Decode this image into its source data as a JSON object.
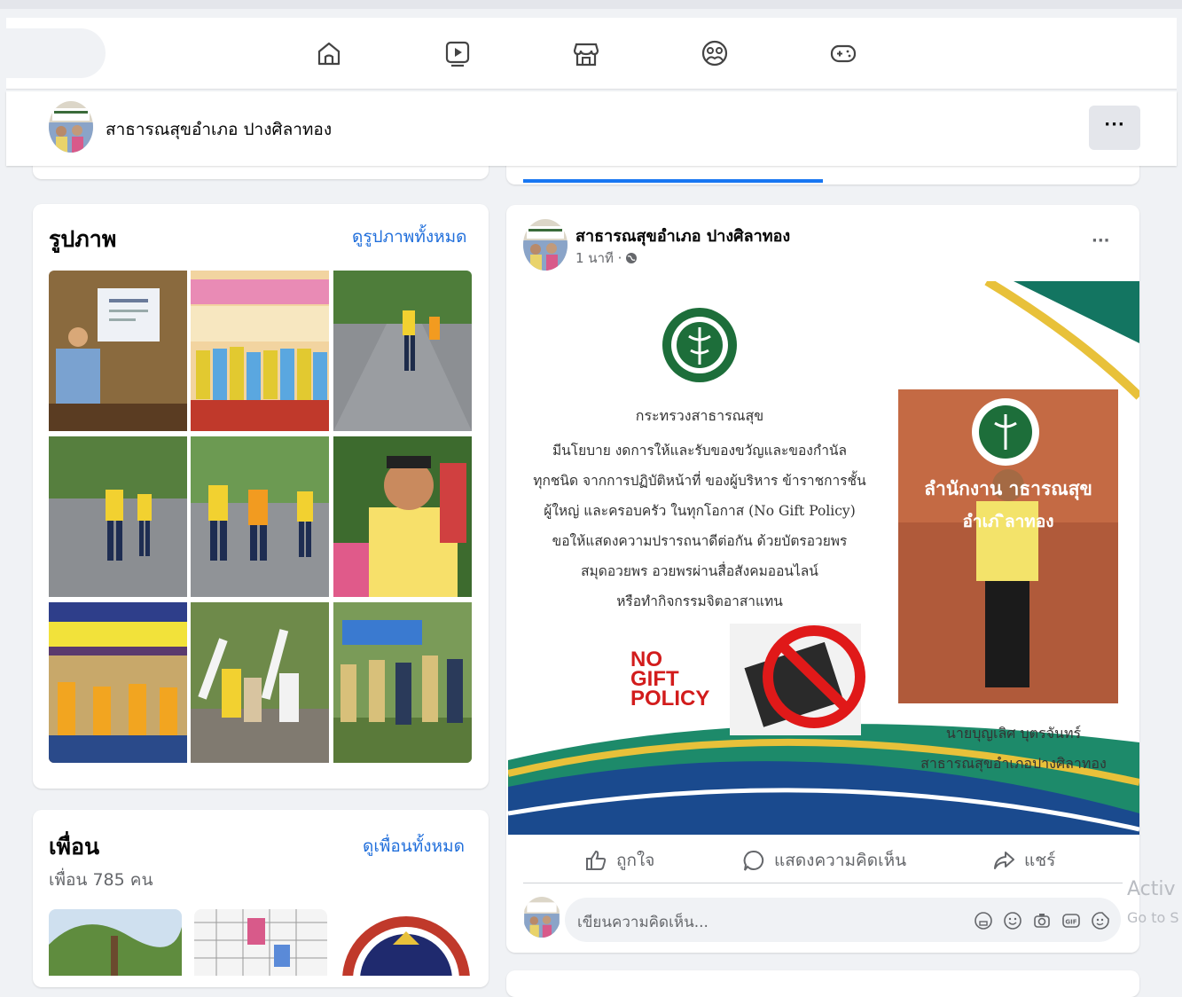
{
  "page": {
    "name": "สาธารณสุขอำเภอ ปางศิลาทอง",
    "more_label": "···"
  },
  "nav": {
    "icons": [
      "home-icon",
      "watch-icon",
      "marketplace-icon",
      "groups-icon",
      "gaming-icon"
    ]
  },
  "photos": {
    "title": "รูปภาพ",
    "see_all": "ดูรูปภาพทั้งหมด"
  },
  "friends": {
    "title": "เพื่อน",
    "count_text": "เพื่อน 785 คน",
    "see_all": "ดูเพื่อนทั้งหมด"
  },
  "post": {
    "author": "สาธารณสุขอำเภอ ปางศิลาทอง",
    "time": "1 นาที ·",
    "more_label": "···",
    "image": {
      "ministry": "กระทรวงสาธารณสุข",
      "body_lines": [
        "มีนโยบาย งดการให้และรับของขวัญและของกำนัล",
        "ทุกชนิด จากการปฏิบัติหน้าที่ ของผู้บริหาร ข้าราชการชั้น",
        "ผู้ใหญ่ และครอบครัว ในทุกโอกาส (No Gift Policy)",
        "ขอให้แสดงความปรารถนาดีต่อกัน ด้วยบัตรอวยพร",
        "สมุดอวยพร อวยพรผ่านสื่อสังคมออนไลน์",
        "หรือทำกิจกรรมจิตอาสาแทน"
      ],
      "no_gift": [
        "NO",
        "GIFT",
        "POLICY"
      ],
      "sign_line1": "ลำนักงาน  าธารณสุข",
      "sign_line2": "อำเภ    ิลาทอง",
      "person_name": "นายบุญเลิศ  บุตรจันทร์",
      "person_title": "สาธารณสุขอำเภอปางศิลาทอง"
    },
    "actions": {
      "like": "ถูกใจ",
      "comment": "แสดงความคิดเห็น",
      "share": "แชร์"
    },
    "comment_placeholder": "เขียนความคิดเห็น..."
  },
  "overlay": {
    "activate": "Activ",
    "goto": "Go to S"
  }
}
